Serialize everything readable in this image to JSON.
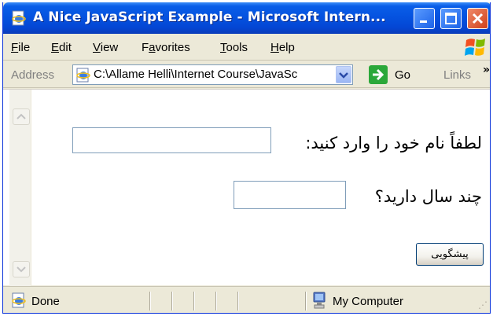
{
  "window": {
    "title": "A Nice JavaScript Example - Microsoft Intern...",
    "controls": {
      "minimize_icon": "minimize-icon",
      "maximize_icon": "maximize-icon",
      "close_icon": "close-icon"
    },
    "title_bar_color": "#0553e0"
  },
  "menu": {
    "items": [
      {
        "label": "File",
        "accel": "F",
        "rest": "ile"
      },
      {
        "label": "Edit",
        "accel": "E",
        "rest": "dit"
      },
      {
        "label": "View",
        "accel": "V",
        "rest": "iew"
      },
      {
        "label": "Favorites",
        "accel": "a",
        "pre": "F",
        "rest": "vorites"
      },
      {
        "label": "Tools",
        "accel": "T",
        "rest": "ools"
      },
      {
        "label": "Help",
        "accel": "H",
        "rest": "elp"
      }
    ]
  },
  "address_bar": {
    "label": "Address",
    "value": "C:\\Allame Helli\\Internet Course\\JavaSc",
    "go_label": "Go",
    "links_label": "Links",
    "chevron": "»"
  },
  "page": {
    "name_label": "لطفاً نام خود را وارد کنید:",
    "name_value": "",
    "age_label": "چند سال دارید؟",
    "age_value": "",
    "predict_button": "پیشگویی"
  },
  "status_bar": {
    "status": "Done",
    "zone": "My Computer"
  }
}
